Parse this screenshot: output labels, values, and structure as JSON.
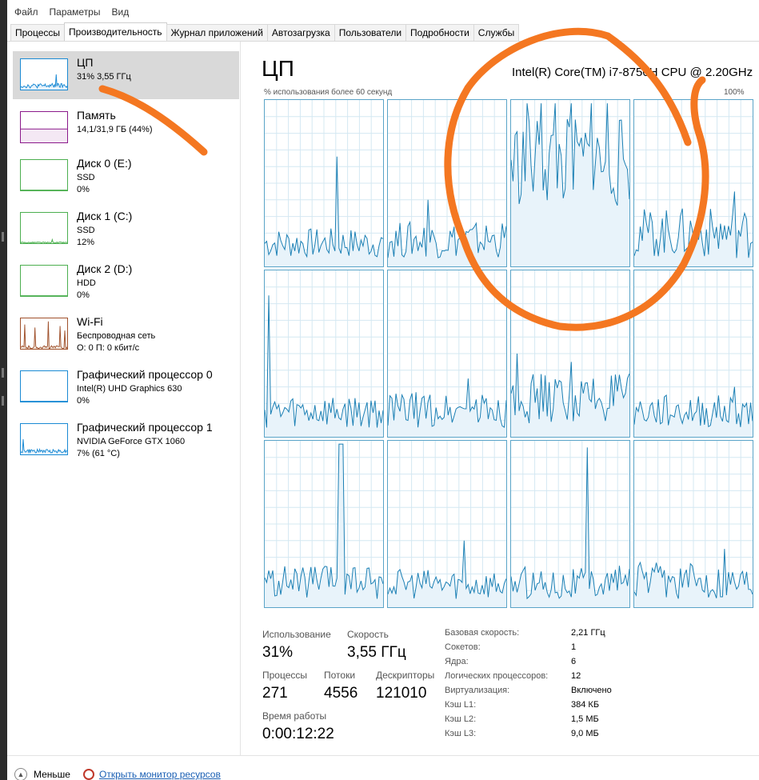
{
  "menu": [
    "Файл",
    "Параметры",
    "Вид"
  ],
  "tabs": [
    {
      "label": "Процессы",
      "active": false
    },
    {
      "label": "Производительность",
      "active": true
    },
    {
      "label": "Журнал приложений",
      "active": false
    },
    {
      "label": "Автозагрузка",
      "active": false
    },
    {
      "label": "Пользователи",
      "active": false
    },
    {
      "label": "Подробности",
      "active": false
    },
    {
      "label": "Службы",
      "active": false
    }
  ],
  "sidebar": {
    "items": [
      {
        "title": "ЦП",
        "sub1": "31%  3,55 ГГц",
        "sub2": "",
        "selected": true,
        "graph_color": "#1a8ad4",
        "fill_color": "#e6f2fb"
      },
      {
        "title": "Память",
        "sub1": "14,1/31,9 ГБ (44%)",
        "sub2": "",
        "selected": false,
        "graph_color": "#8b1a8b",
        "fill_color": "#f4e8f4"
      },
      {
        "title": "Диск 0 (E:)",
        "sub1": "SSD",
        "sub2": "0%",
        "selected": false,
        "graph_color": "#4caf50",
        "fill_color": "#eaf6ea"
      },
      {
        "title": "Диск 1 (C:)",
        "sub1": "SSD",
        "sub2": "12%",
        "selected": false,
        "graph_color": "#4caf50",
        "fill_color": "#eaf6ea"
      },
      {
        "title": "Диск 2 (D:)",
        "sub1": "HDD",
        "sub2": "0%",
        "selected": false,
        "graph_color": "#4caf50",
        "fill_color": "#eaf6ea"
      },
      {
        "title": "Wi-Fi",
        "sub1": "Беспроводная сеть",
        "sub2": "О: 0 П: 0 кбит/с",
        "selected": false,
        "graph_color": "#a0522d",
        "fill_color": "#f6eee6"
      },
      {
        "title": "Графический процессор 0",
        "sub1": "Intel(R) UHD Graphics 630",
        "sub2": "0%",
        "selected": false,
        "graph_color": "#1a8ad4",
        "fill_color": "#e6f2fb"
      },
      {
        "title": "Графический процессор 1",
        "sub1": "NVIDIA GeForce GTX 1060",
        "sub2": "7% (61 °C)",
        "selected": false,
        "graph_color": "#1a8ad4",
        "fill_color": "#e6f2fb"
      }
    ]
  },
  "main": {
    "title": "ЦП",
    "cpu_model": "Intel(R) Core(TM) i7-8750H CPU @ 2.20GHz",
    "axis_left": "% использования более 60 секунд",
    "axis_right": "100%",
    "logical_cores": 12
  },
  "stats": {
    "usage_label": "Использование",
    "usage_value": "31%",
    "speed_label": "Скорость",
    "speed_value": "3,55 ГГц",
    "processes_label": "Процессы",
    "processes_value": "271",
    "threads_label": "Потоки",
    "threads_value": "4556",
    "handles_label": "Дескрипторы",
    "handles_value": "121010",
    "uptime_label": "Время работы",
    "uptime_value": "0:00:12:22"
  },
  "info": [
    {
      "k": "Базовая скорость:",
      "v": "2,21 ГГц"
    },
    {
      "k": "Сокетов:",
      "v": "1"
    },
    {
      "k": "Ядра:",
      "v": "6"
    },
    {
      "k": "Логических процессоров:",
      "v": "12"
    },
    {
      "k": "Виртуализация:",
      "v": "Включено"
    },
    {
      "k": "Кэш L1:",
      "v": "384 КБ"
    },
    {
      "k": "Кэш L2:",
      "v": "1,5 МБ"
    },
    {
      "k": "Кэш L3:",
      "v": "9,0 МБ"
    }
  ],
  "footer": {
    "less_label": "Меньше",
    "monitor_link": "Открыть монитор ресурсов"
  },
  "colors": {
    "graph_line": "#1a7fb4",
    "graph_fill": "#e8f3fa",
    "graph_border": "#5aa4c8",
    "grid_line": "#d4e8f2",
    "annotation": "#f47721"
  }
}
